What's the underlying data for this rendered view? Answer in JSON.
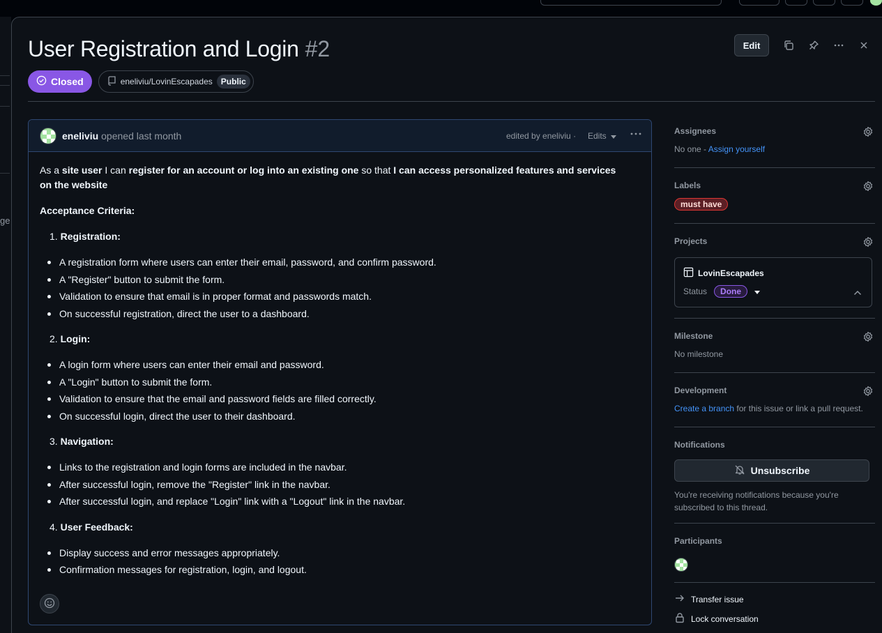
{
  "issue": {
    "title": "User Registration and Login",
    "number": "#2",
    "state": "Closed",
    "repo": "eneliviu/LovinEscapades",
    "visibility": "Public",
    "edit_label": "Edit"
  },
  "comment": {
    "author": "eneliviu",
    "opened": "opened last month",
    "edited_by": "edited by eneliviu",
    "edits_label": "Edits",
    "intro": {
      "t1": "As a ",
      "b1": "site user",
      "t2": " I can ",
      "b2": "register for an account or log into an existing one",
      "t3": " so that ",
      "b3": "I can access personalized features and services on the website"
    },
    "ac_title": "Acceptance Criteria:",
    "sections": [
      {
        "num": "1.",
        "title": "Registration:",
        "items": [
          "A registration form where users can enter their email, password, and confirm password.",
          "A \"Register\" button to submit the form.",
          "Validation to ensure that email is in proper format and passwords match.",
          "On successful registration, direct the user to a dashboard."
        ]
      },
      {
        "num": "2.",
        "title": "Login:",
        "items": [
          "A login form where users can enter their email and password.",
          "A \"Login\" button to submit the form.",
          "Validation to ensure that the email and password fields are filled correctly.",
          "On successful login, direct the user to their dashboard."
        ]
      },
      {
        "num": "3.",
        "title": "Navigation:",
        "items": [
          "Links to the registration and login forms are included in the navbar.",
          "After successful login, remove the \"Register\" link in the navbar.",
          "After successful login, and replace \"Login\" link with a \"Logout\" link in the navbar."
        ]
      },
      {
        "num": "4.",
        "title": "User Feedback:",
        "items": [
          "Display success and error messages appropriately.",
          "Confirmation messages for registration, login, and logout."
        ]
      }
    ]
  },
  "sidebar": {
    "assignees": {
      "title": "Assignees",
      "none": "No one",
      "dash": " - ",
      "assign": "Assign yourself"
    },
    "labels": {
      "title": "Labels",
      "label": "must have"
    },
    "projects": {
      "title": "Projects",
      "project": "LovinEscapades",
      "status_label": "Status",
      "status_value": "Done"
    },
    "milestone": {
      "title": "Milestone",
      "value": "No milestone"
    },
    "development": {
      "title": "Development",
      "link": "Create a branch",
      "text": " for this issue or link a pull request."
    },
    "notifications": {
      "title": "Notifications",
      "button": "Unsubscribe",
      "text": "You're receiving notifications because you're subscribed to this thread."
    },
    "participants": {
      "title": "Participants"
    },
    "actions": {
      "transfer": "Transfer issue",
      "lock": "Lock conversation"
    }
  },
  "background": {
    "left_text": "ge"
  },
  "colors": {
    "closed": "#8957e5",
    "link": "#4493f8",
    "label_must_have": "#da3633"
  }
}
